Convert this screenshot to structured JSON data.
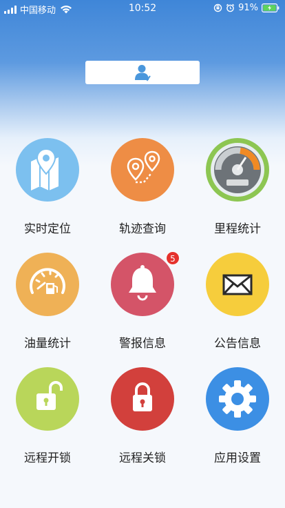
{
  "status_bar": {
    "carrier": "中国移动",
    "time": "10:52",
    "battery": "91%"
  },
  "header": {
    "user_icon": "user-icon"
  },
  "menu": [
    {
      "label": "实时定位",
      "icon": "map-pin-icon",
      "color": "#7cc0ef"
    },
    {
      "label": "轨迹查询",
      "icon": "route-icon",
      "color": "#ee8d45"
    },
    {
      "label": "里程统计",
      "icon": "speedometer-icon",
      "color": "#8dc652"
    },
    {
      "label": "油量统计",
      "icon": "fuel-gauge-icon",
      "color": "#efb156"
    },
    {
      "label": "警报信息",
      "icon": "bell-icon",
      "color": "#d45468",
      "badge": "5"
    },
    {
      "label": "公告信息",
      "icon": "envelope-icon",
      "color": "#f6cd3c"
    },
    {
      "label": "远程开锁",
      "icon": "unlock-icon",
      "color": "#b9d65a"
    },
    {
      "label": "远程关锁",
      "icon": "lock-icon",
      "color": "#d2403c"
    },
    {
      "label": "应用设置",
      "icon": "gear-icon",
      "color": "#3c8fe4"
    }
  ]
}
